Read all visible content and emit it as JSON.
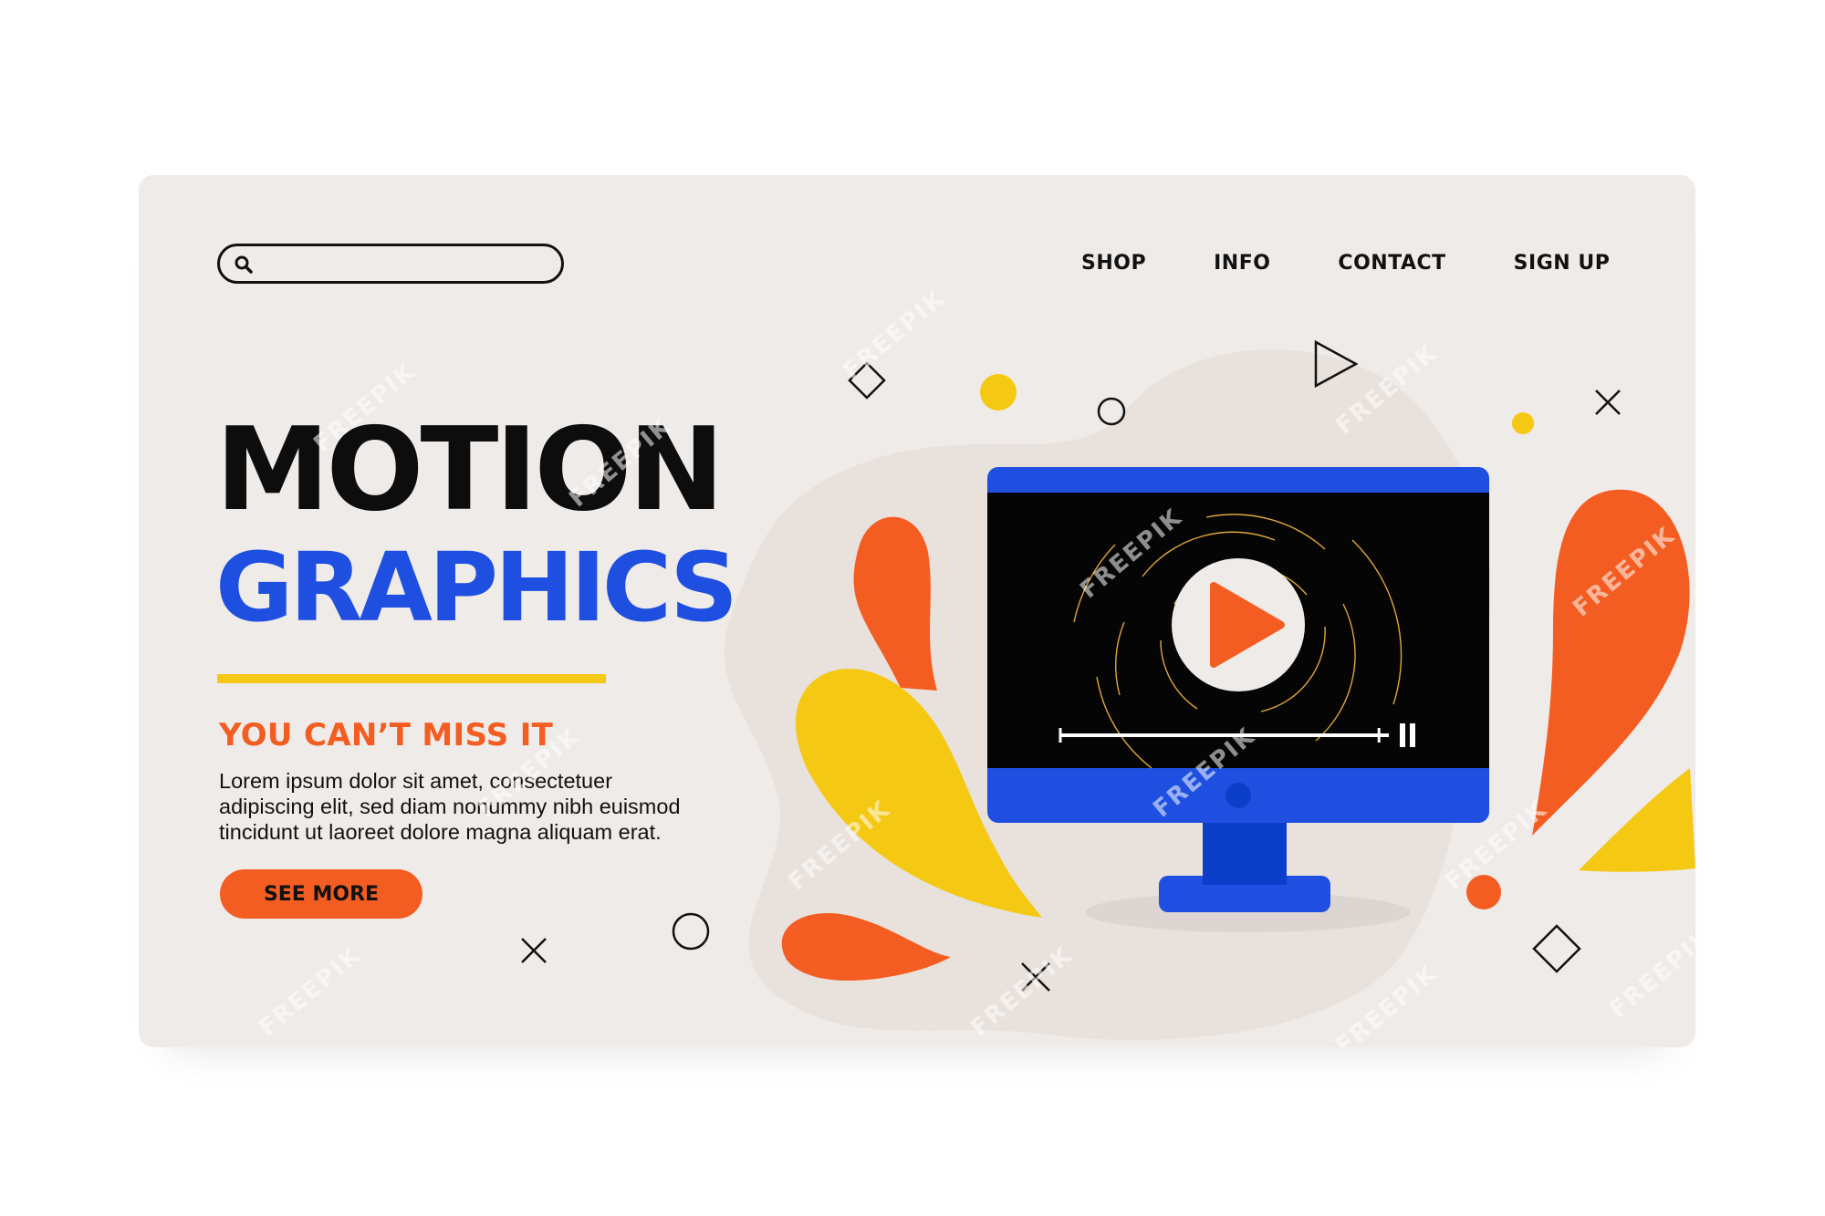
{
  "search": {
    "placeholder": "",
    "value": "",
    "icon": "search-icon"
  },
  "nav": {
    "items": [
      {
        "label": "SHOP"
      },
      {
        "label": "INFO"
      },
      {
        "label": "CONTACT"
      },
      {
        "label": "SIGN UP"
      }
    ]
  },
  "hero": {
    "title_line1": "MOTION",
    "title_line2": "GRAPHICS",
    "tagline": "YOU CAN’T MISS IT",
    "body_line1": "Lorem ipsum dolor sit amet, consectetuer",
    "body_line2": "adipiscing elit, sed diam nonummy nibh euismod",
    "body_line3": "tincidunt ut laoreet dolore magna aliquam erat.",
    "cta_label": "SEE MORE"
  },
  "monitor": {
    "icons": [
      "play-icon",
      "pause-icon"
    ],
    "progress": 0.97
  },
  "watermark": "FREEPIK",
  "colors": {
    "card_background": "#efebe8",
    "title_black": "#0d0d0d",
    "title_blue": "#1f4fe0",
    "accent_orange": "#f45d22",
    "accent_yellow": "#f5c814",
    "monitor_blue": "#1f4fe0",
    "monitor_stand": "#0c3fc9",
    "screen_black": "#050505"
  }
}
